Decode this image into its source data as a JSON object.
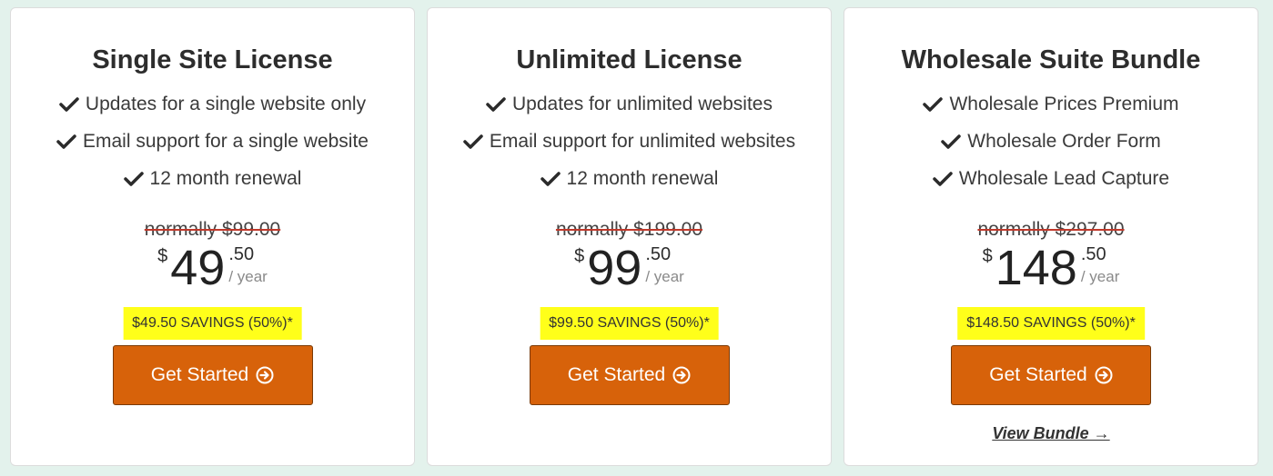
{
  "plans": [
    {
      "title": "Single Site License",
      "features": [
        "Updates for a single website only",
        "Email support for a single website",
        "12 month renewal"
      ],
      "normal_price": "normally $99.00",
      "currency": "$",
      "price_whole": "49",
      "price_cents": ".50",
      "per": "/ year",
      "savings": "$49.50 SAVINGS (50%)*",
      "cta": "Get Started"
    },
    {
      "title": "Unlimited License",
      "features": [
        "Updates for unlimited websites",
        "Email support for unlimited websites",
        "12 month renewal"
      ],
      "normal_price": "normally $199.00",
      "currency": "$",
      "price_whole": "99",
      "price_cents": ".50",
      "per": "/ year",
      "savings": "$99.50 SAVINGS (50%)*",
      "cta": "Get Started"
    },
    {
      "title": "Wholesale Suite Bundle",
      "features": [
        "Wholesale Prices Premium",
        "Wholesale Order Form",
        "Wholesale Lead Capture"
      ],
      "normal_price": "normally $297.00",
      "currency": "$",
      "price_whole": "148",
      "price_cents": ".50",
      "per": "/ year",
      "savings": "$148.50 SAVINGS (50%)*",
      "cta": "Get Started",
      "link": "View Bundle →"
    }
  ],
  "icons": {
    "feature": "checkmark-icon",
    "cta": "circle-arrow-right-icon"
  },
  "colors": {
    "cta": "#d7620a",
    "savings_highlight": "#ffff1a",
    "strike": "#c0392b",
    "background": "#e3f2ec"
  }
}
